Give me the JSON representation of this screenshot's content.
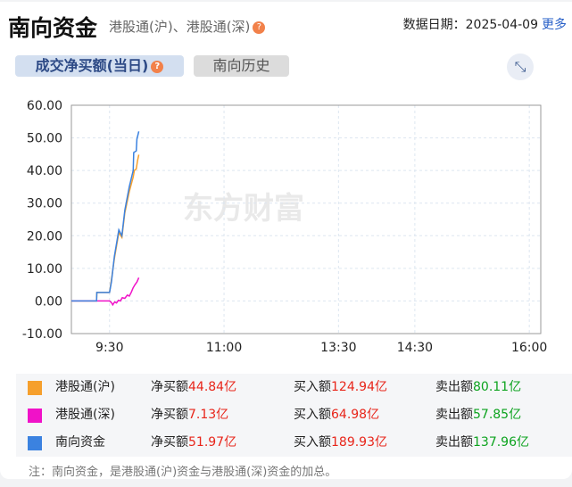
{
  "header": {
    "title": "南向资金",
    "subtitle": "港股通(沪)、港股通(深)",
    "date_label": "数据日期：",
    "date": "2025-04-09",
    "more": "更多"
  },
  "tabs": [
    {
      "label": "成交净买额(当日)",
      "active": true
    },
    {
      "label": "南向历史",
      "active": false
    }
  ],
  "watermark": "东方财富",
  "chart_data": {
    "type": "line",
    "x_unit": "trading minutes since 9:00 (lunch 12:00-13:00 skipped)",
    "xticks": [
      {
        "label": "9:30",
        "m": 30
      },
      {
        "label": "11:00",
        "m": 120
      },
      {
        "label": "13:30",
        "m": 210
      },
      {
        "label": "14:30",
        "m": 270
      },
      {
        "label": "16:00",
        "m": 360
      }
    ],
    "xlim": [
      0,
      369
    ],
    "ylim": [
      -10,
      60
    ],
    "yticks": [
      "-10.00",
      "0.00",
      "10.00",
      "20.00",
      "30.00",
      "40.00",
      "50.00",
      "60.00"
    ],
    "grid": true,
    "series": [
      {
        "name": "港股通(沪)",
        "color": "#f6a02d",
        "points": [
          [
            0,
            0
          ],
          [
            19.8,
            0
          ],
          [
            20,
            2.6
          ],
          [
            30,
            2.6
          ],
          [
            31.5,
            6.5
          ],
          [
            33.8,
            13
          ],
          [
            37.3,
            21
          ],
          [
            39.7,
            19.5
          ],
          [
            42,
            27
          ],
          [
            45.5,
            33.5
          ],
          [
            48.6,
            38
          ],
          [
            49.5,
            40
          ],
          [
            51,
            40.5
          ],
          [
            52,
            43
          ],
          [
            53,
            44.84
          ]
        ]
      },
      {
        "name": "港股通(深)",
        "color": "#f012c8",
        "points": [
          [
            0,
            0
          ],
          [
            30,
            0
          ],
          [
            31.5,
            -0.5
          ],
          [
            32.5,
            -1.2
          ],
          [
            34,
            -0.3
          ],
          [
            35.5,
            -0.6
          ],
          [
            37,
            0.2
          ],
          [
            38.5,
            0
          ],
          [
            40,
            1
          ],
          [
            42,
            0.8
          ],
          [
            44,
            1.8
          ],
          [
            45.5,
            1.5
          ],
          [
            47,
            2.6
          ],
          [
            48.5,
            4
          ],
          [
            50,
            5
          ],
          [
            51.5,
            5.8
          ],
          [
            53,
            7.13
          ]
        ]
      },
      {
        "name": "南向资金",
        "color": "#3b82e0",
        "points": [
          [
            0,
            0
          ],
          [
            19.8,
            0
          ],
          [
            20,
            2.6
          ],
          [
            30,
            2.6
          ],
          [
            31.5,
            5.9
          ],
          [
            33.8,
            13.7
          ],
          [
            37.3,
            21.8
          ],
          [
            39.7,
            20
          ],
          [
            42,
            27.8
          ],
          [
            45.5,
            35
          ],
          [
            48.6,
            40
          ],
          [
            49,
            45.5
          ],
          [
            51,
            46
          ],
          [
            51.5,
            49.6
          ],
          [
            53,
            51.97
          ]
        ]
      }
    ]
  },
  "legend": [
    {
      "name": "港股通(沪)",
      "color": "#f6a02d",
      "net_label": "净买额",
      "net": "44.84亿",
      "buy_label": "买入额",
      "buy": "124.94亿",
      "sell_label": "卖出额",
      "sell": "80.11亿"
    },
    {
      "name": "港股通(深)",
      "color": "#f012c8",
      "net_label": "净买额",
      "net": "7.13亿",
      "buy_label": "买入额",
      "buy": "64.98亿",
      "sell_label": "卖出额",
      "sell": "57.85亿"
    },
    {
      "name": "南向资金",
      "color": "#3b82e0",
      "net_label": "净买额",
      "net": "51.97亿",
      "buy_label": "买入额",
      "buy": "189.93亿",
      "sell_label": "卖出额",
      "sell": "137.96亿"
    }
  ],
  "note": "注：南向资金，是港股通(沪)资金与港股通(深)资金的加总。"
}
